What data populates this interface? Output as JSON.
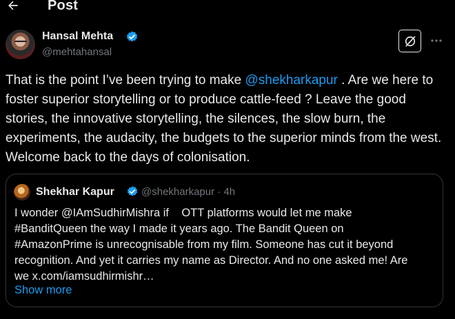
{
  "header": {
    "title": "Post",
    "back_icon": "arrow-left-icon"
  },
  "post": {
    "author_name": "Hansal Mehta",
    "author_handle": "@mehtahansal",
    "verified_color": "#1d9bf0",
    "text_before_mention": "That is the point I’ve been trying to make ",
    "mention": "@shekharkapur",
    "text_after_mention": " . Are we here to foster superior storytelling or to produce cattle-feed ? Leave the good stories, the innovative storytelling, the silences, the slow burn, the experiments, the audacity, the budgets to the superior minds from the west. Welcome back to the days of colonisation.",
    "grok_icon": "grok-icon",
    "more_icon": "more-horizontal-icon"
  },
  "quote": {
    "author_name": "Shekhar Kapur",
    "author_handle": "@shekharkapur · 4h",
    "lines": [
      "I wonder @IAmSudhirMishra if    OTT platforms would let me make",
      "#BanditQueen the way I made it years ago. The Bandit Queen on",
      "#AmazonPrime is unrecognisable from my film. Someone has cut it beyond",
      "recognition. And yet it carries my name as Director. And no one asked me! Are",
      "we x.com/iamsudhirmishr…"
    ],
    "show_more": "Show more"
  },
  "colors": {
    "background": "#000000",
    "text": "#e7e9ea",
    "secondary": "#71767b",
    "accent": "#1d9bf0",
    "border": "#2f3336"
  }
}
